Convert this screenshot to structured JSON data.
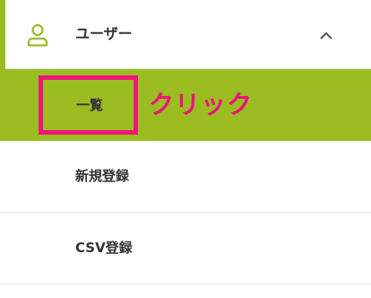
{
  "nav": {
    "section": {
      "label": "ユーザー",
      "icon": "user-icon",
      "expanded_icon": "chevron-up-icon",
      "accent_color": "#9bbd22"
    },
    "items": [
      {
        "label": "一覧",
        "active": true
      },
      {
        "label": "新規登録",
        "active": false
      },
      {
        "label": "CSV登録",
        "active": false
      }
    ]
  },
  "annotation": {
    "text": "クリック",
    "color": "#e8147a"
  }
}
